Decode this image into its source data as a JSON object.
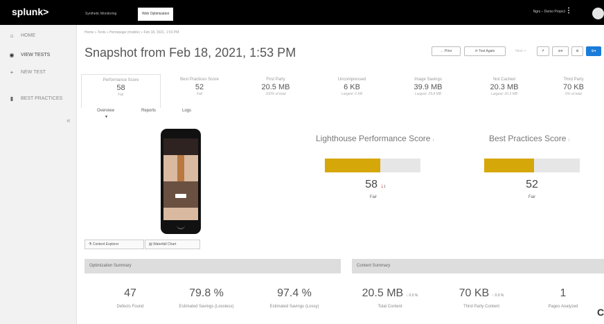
{
  "app": {
    "logo": "splunk>",
    "tabs": [
      "Synthetic Monitoring",
      "Web Optimization"
    ],
    "project": "Ngrx – Demo Project",
    "menu_glyph": "⋮"
  },
  "sidebar": {
    "items": [
      {
        "label": "HOME",
        "icon": "home-icon"
      },
      {
        "label": "VIEW TESTS",
        "icon": "search-icon"
      },
      {
        "label": "NEW TEST",
        "icon": "plus-icon"
      },
      {
        "label": "BEST PRACTICES",
        "icon": "book-icon"
      }
    ],
    "collapse": "«"
  },
  "breadcrumb": "Home » Tests » Homepage (mobile) » Feb 18, 2021, 1:53 PM",
  "title": "Snapshot from Feb 18, 2021, 1:53 PM",
  "toolbar": {
    "prior": "← Prior",
    "test_again": "⟳ Test Again",
    "next": "Next ⇒",
    "share": "↱",
    "compare": "⊘▾",
    "settings": "⚙",
    "more": "⚙▾"
  },
  "metrics": [
    {
      "label": "Performance Score",
      "value": "58",
      "sub": "Fair"
    },
    {
      "label": "Best Practices Score",
      "value": "52",
      "sub": "Fail"
    },
    {
      "label": "First Party",
      "value": "20.5 MB",
      "sub": "100% of total"
    },
    {
      "label": "Uncompressed",
      "value": "6 KB",
      "sub": "Largest: 6 KB"
    },
    {
      "label": "Image Savings",
      "value": "39.9 MB",
      "sub": "Largest: 29.8 MB"
    },
    {
      "label": "Not Cached",
      "value": "20.3 MB",
      "sub": "Largest: 20.3 MB"
    },
    {
      "label": "Third Party",
      "value": "70 KB",
      "sub": "0% of total"
    }
  ],
  "subtabs": [
    "Overview",
    "Reports",
    "Logs"
  ],
  "scores": {
    "lighthouse": {
      "title": "Lighthouse Performance Score",
      "info": "i",
      "value": "58",
      "delta": "1",
      "delta_arrow": "↓",
      "rating": "Fair",
      "fill": 0.58,
      "bar_color": "#d6a709"
    },
    "best": {
      "title": "Best Practices Score",
      "info": "i",
      "value": "52",
      "rating": "Fair",
      "fill": 0.52
    }
  },
  "explorer": {
    "content": "⚗ Content Explorer",
    "waterfall": "▤ Waterfall Chart"
  },
  "panels": {
    "optimization": "Optimization Summary",
    "content": "Content Summary"
  },
  "summary": [
    {
      "value": "47",
      "label": "Defects Found"
    },
    {
      "value": "79.8 %",
      "label": "Estimated Savings (Lossless)"
    },
    {
      "value": "97.4 %",
      "label": "Estimated Savings (Lossy)"
    },
    {
      "value": "20.5 MB",
      "delta": "↓ 0.0 %",
      "label": "Total Content"
    },
    {
      "value": "70 KB",
      "delta": "↑ 0.0 %",
      "label": "Third Party Content"
    },
    {
      "value": "1",
      "label": "Pages Analyzed"
    }
  ],
  "corner": "C",
  "colors": {
    "accent": "#1a7bd9",
    "bar": "#d6a709",
    "decrease": "#d9262b",
    "topbar": "#000000"
  }
}
